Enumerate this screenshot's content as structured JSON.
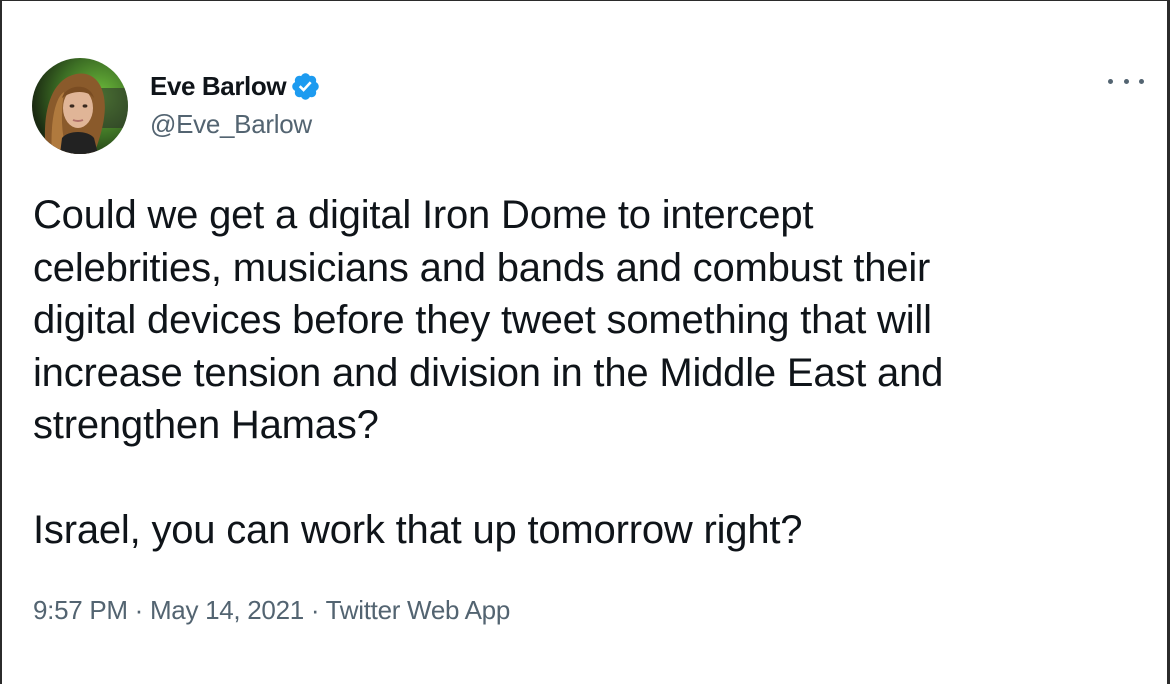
{
  "author": {
    "display_name": "Eve Barlow",
    "handle": "@Eve_Barlow",
    "verified": true,
    "avatar_icon": "profile-photo",
    "verified_icon": "verified-badge-icon",
    "verified_color": "#1d9bf0"
  },
  "menu": {
    "icon": "more-options-icon"
  },
  "tweet": {
    "lines": [
      "Could we get a digital Iron Dome to intercept",
      "celebrities, musicians and bands and combust their",
      "digital devices before they tweet something that will",
      "increase tension and division in the Middle East and",
      "strengthen Hamas?"
    ],
    "second_paragraph": "Israel, you can work that up tomorrow right?"
  },
  "meta": {
    "time": "9:57 PM",
    "separator": " · ",
    "date": "May 14, 2021",
    "source": "Twitter Web App"
  },
  "colors": {
    "text": "#0f1419",
    "secondary": "#536471",
    "accent": "#1d9bf0"
  }
}
